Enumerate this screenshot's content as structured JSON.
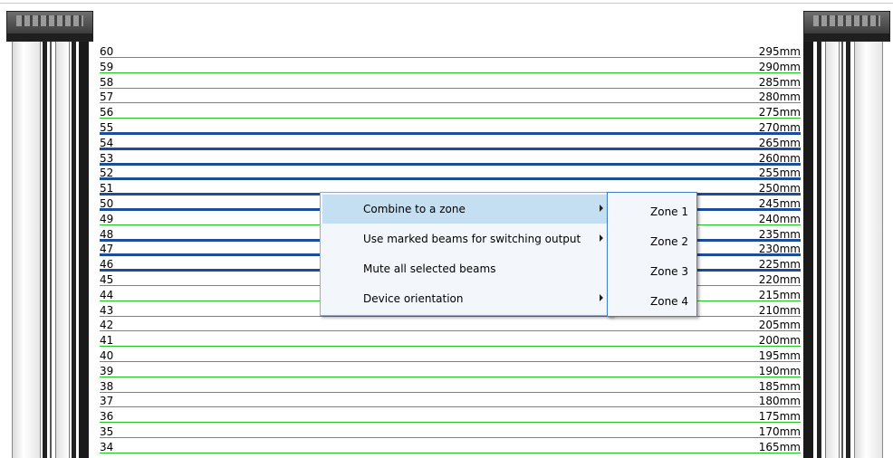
{
  "beams": [
    {
      "num": "60",
      "mm": "295mm",
      "selected": false
    },
    {
      "num": "59",
      "mm": "290mm",
      "selected": false
    },
    {
      "num": "58",
      "mm": "285mm",
      "selected": false
    },
    {
      "num": "57",
      "mm": "280mm",
      "selected": false
    },
    {
      "num": "56",
      "mm": "275mm",
      "selected": false
    },
    {
      "num": "55",
      "mm": "270mm",
      "selected": true
    },
    {
      "num": "54",
      "mm": "265mm",
      "selected": true
    },
    {
      "num": "53",
      "mm": "260mm",
      "selected": true
    },
    {
      "num": "52",
      "mm": "255mm",
      "selected": true
    },
    {
      "num": "51",
      "mm": "250mm",
      "selected": true
    },
    {
      "num": "50",
      "mm": "245mm",
      "selected": true
    },
    {
      "num": "49",
      "mm": "240mm",
      "selected": false
    },
    {
      "num": "48",
      "mm": "235mm",
      "selected": true
    },
    {
      "num": "47",
      "mm": "230mm",
      "selected": true
    },
    {
      "num": "46",
      "mm": "225mm",
      "selected": true
    },
    {
      "num": "45",
      "mm": "220mm",
      "selected": false
    },
    {
      "num": "44",
      "mm": "215mm",
      "selected": false
    },
    {
      "num": "43",
      "mm": "210mm",
      "selected": false
    },
    {
      "num": "42",
      "mm": "205mm",
      "selected": false
    },
    {
      "num": "41",
      "mm": "200mm",
      "selected": false
    },
    {
      "num": "40",
      "mm": "195mm",
      "selected": false
    },
    {
      "num": "39",
      "mm": "190mm",
      "selected": false
    },
    {
      "num": "38",
      "mm": "185mm",
      "selected": false
    },
    {
      "num": "37",
      "mm": "180mm",
      "selected": false
    },
    {
      "num": "36",
      "mm": "175mm",
      "selected": false
    },
    {
      "num": "35",
      "mm": "170mm",
      "selected": false
    },
    {
      "num": "34",
      "mm": "165mm",
      "selected": false
    }
  ],
  "context_menu": {
    "items": [
      {
        "label": "Combine to a zone",
        "has_submenu": true,
        "highlighted": true
      },
      {
        "label": "Use marked beams for switching output",
        "has_submenu": true,
        "highlighted": false
      },
      {
        "label": "Mute all selected beams",
        "has_submenu": false,
        "highlighted": false
      },
      {
        "label": "Device orientation",
        "has_submenu": true,
        "highlighted": false
      }
    ]
  },
  "zone_submenu": {
    "items": [
      "Zone 1",
      "Zone 2",
      "Zone 3",
      "Zone 4"
    ]
  },
  "colors": {
    "beam_line": "#22c222",
    "selected_beam": "#1c4c9c",
    "menu_highlight": "#c4dff2"
  }
}
